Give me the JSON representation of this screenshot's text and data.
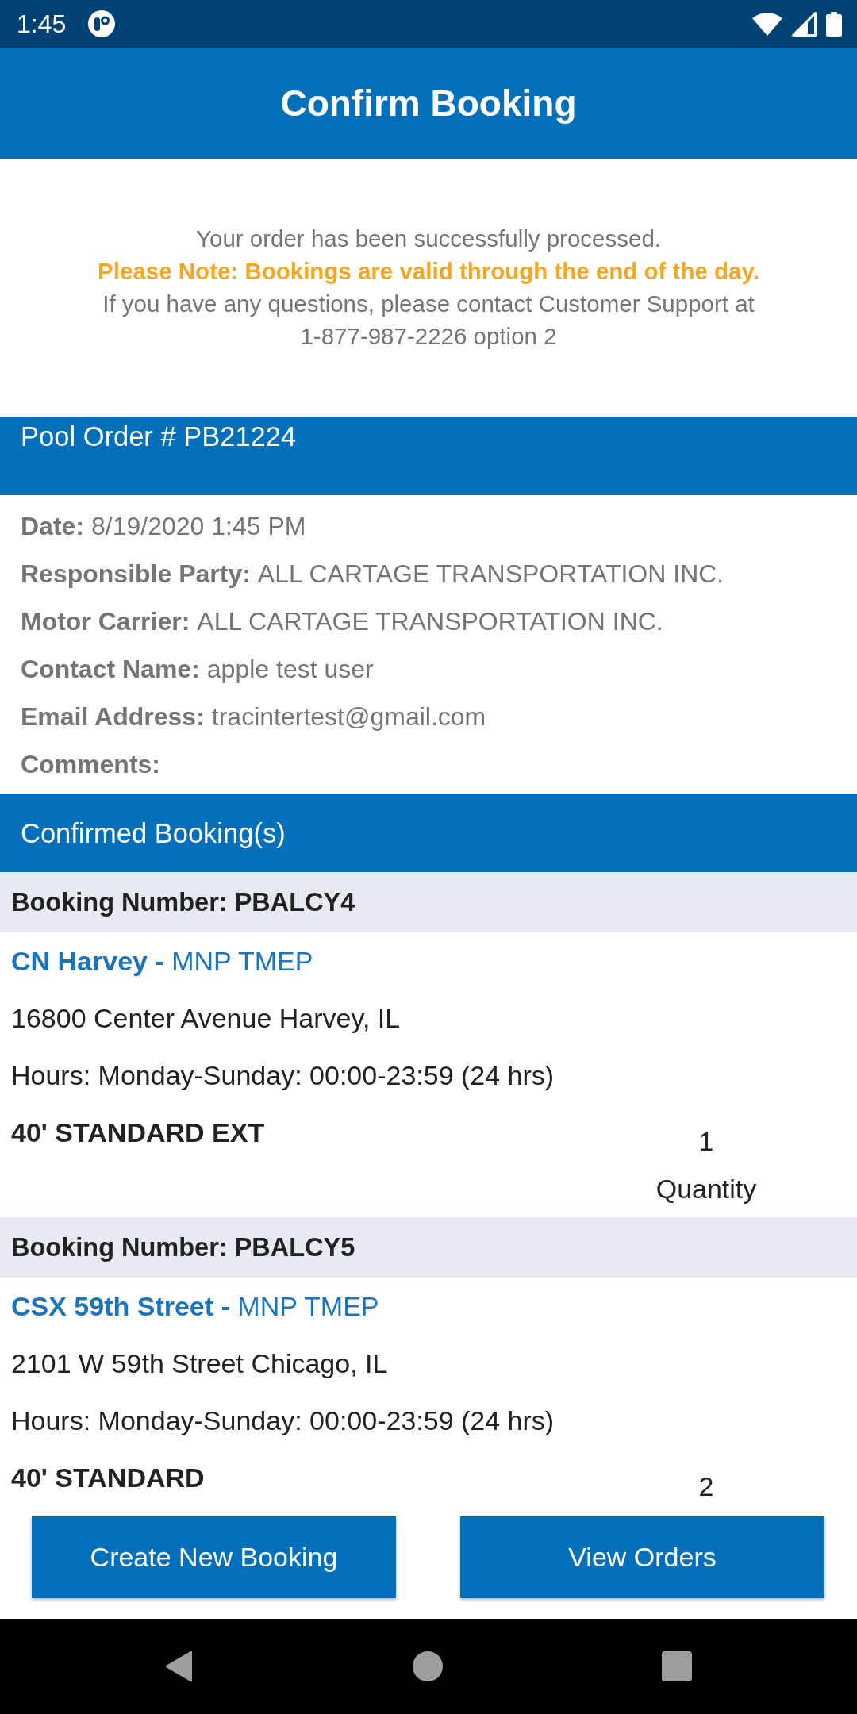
{
  "status_bar": {
    "time": "1:45"
  },
  "app_bar": {
    "title": "Confirm Booking"
  },
  "message": {
    "lines": [
      {
        "kind": "plain",
        "text": "Your order has been successfully processed."
      },
      {
        "kind": "note",
        "text": "Please Note: Bookings are valid through the end of the day."
      },
      {
        "kind": "plain",
        "text": "If you have any questions, please contact Customer Support at 1-877-987-2226 option 2"
      }
    ]
  },
  "order": {
    "title": "Pool Order # PB21224",
    "fields": [
      {
        "label": "Date:",
        "value": "8/19/2020 1:45 PM"
      },
      {
        "label": "Responsible Party:",
        "value": "ALL CARTAGE TRANSPORTATION INC."
      },
      {
        "label": "Motor Carrier:",
        "value": "ALL CARTAGE TRANSPORTATION INC."
      },
      {
        "label": "Contact Name:",
        "value": "apple test user"
      },
      {
        "label": "Email Address:",
        "value": "tracintertest@gmail.com"
      },
      {
        "label": "Comments:"
      }
    ]
  },
  "bookings": {
    "title": "Confirmed Booking(s)",
    "items": [
      {
        "number": "Booking Number: PBALCY4",
        "location": "**CN Harvey -** MNP TMEP",
        "address": "16800 Center Avenue Harvey, IL",
        "hours": "Hours: Monday-Sunday: 00:00-23:59 (24 hrs)",
        "container": "40' STANDARD EXT",
        "quantity": "1",
        "quantity_label": "Quantity"
      },
      {
        "number": "Booking Number: PBALCY5",
        "location": "**CSX 59th Street -** MNP TMEP",
        "address": "2101 W 59th Street Chicago, IL",
        "hours": "Hours: Monday-Sunday: 00:00-23:59 (24 hrs)",
        "container": "40' STANDARD",
        "quantity": "2"
      }
    ]
  },
  "buttons": [
    {
      "label": "Create New Booking"
    },
    {
      "label": "View Orders"
    }
  ]
}
